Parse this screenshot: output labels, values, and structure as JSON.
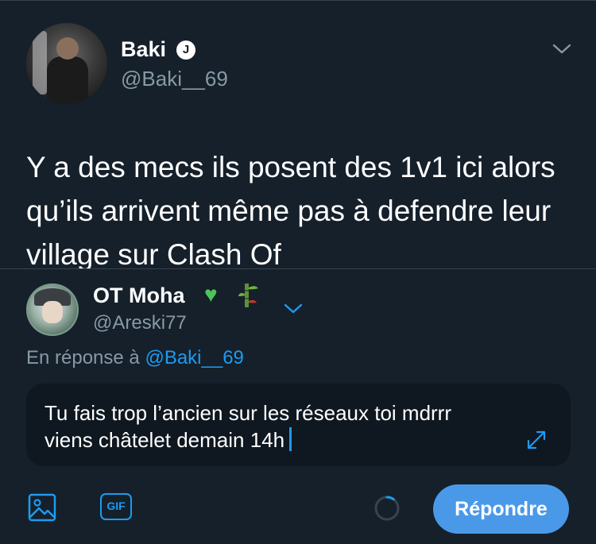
{
  "tweet": {
    "author_name": "Baki",
    "verified_badge": "J",
    "author_handle": "@Baki__69",
    "text": "Y a des mecs ils posent des 1v1 ici alors qu’ils arrivent même pas à defendre leur village sur Clash Of"
  },
  "composer": {
    "account_name": "OT Moha",
    "name_emojis": [
      "green-heart-icon",
      "bamboo-icon"
    ],
    "account_handle": "@Areski77",
    "reply_prefix": "En réponse à",
    "reply_mention": "@Baki__69",
    "input_value": "Tu fais trop l’ancien sur les réseaux toi mdrrr viens châtelet demain 14h",
    "gif_label": "GIF",
    "reply_button_label": "Répondre",
    "char_progress": 0.1
  },
  "colors": {
    "background": "#15202b",
    "accent": "#1d9bf0",
    "button": "#4a99e9",
    "muted_text": "#8899a6",
    "input_bg": "#0f1720"
  }
}
